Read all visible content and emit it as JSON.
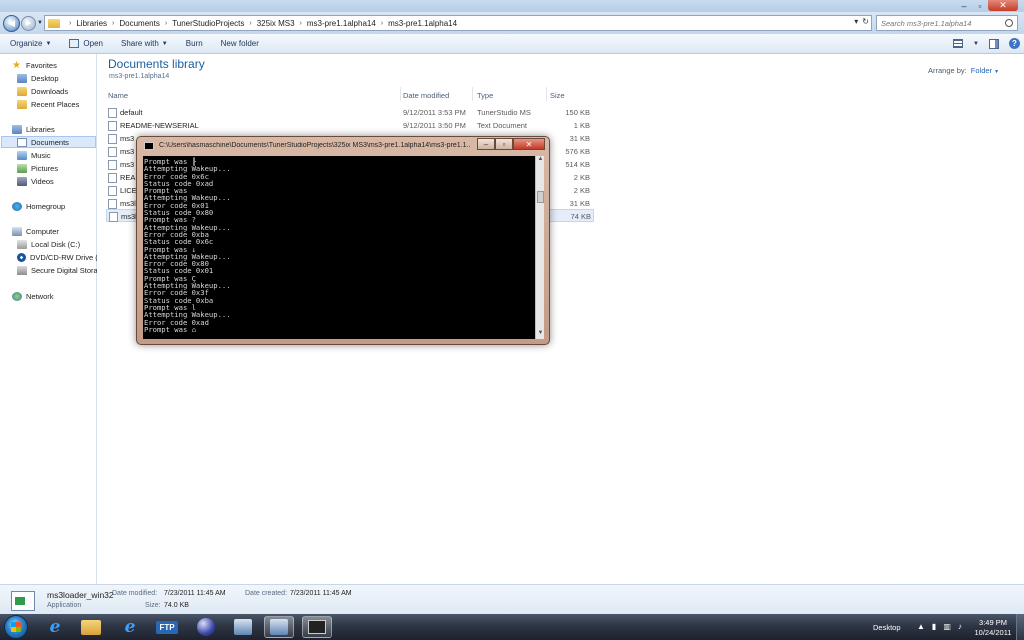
{
  "window_controls": {
    "minimize": "–",
    "maximize": "▫",
    "close": "✕"
  },
  "address": {
    "breadcrumbs": [
      "Libraries",
      "Documents",
      "TunerStudioProjects",
      "325ix MS3",
      "ms3-pre1.1alpha14",
      "ms3-pre1.1alpha14"
    ],
    "separator": "›"
  },
  "search": {
    "placeholder": "Search ms3-pre1.1alpha14"
  },
  "toolbar": {
    "organize": "Organize",
    "open": "Open",
    "share_with": "Share with",
    "burn": "Burn",
    "new_folder": "New folder",
    "help": "?"
  },
  "nav": {
    "favorites": "Favorites",
    "desktop": "Desktop",
    "downloads": "Downloads",
    "recent_places": "Recent Places",
    "libraries": "Libraries",
    "documents": "Documents",
    "music": "Music",
    "pictures": "Pictures",
    "videos": "Videos",
    "homegroup": "Homegroup",
    "computer": "Computer",
    "local_disk": "Local Disk (C:)",
    "dvd_drive": "DVD/CD-RW Drive (",
    "sd_storage": "Secure Digital Storag",
    "network": "Network"
  },
  "library": {
    "title": "Documents library",
    "subtitle": "ms3-pre1.1alpha14",
    "arrange_by_label": "Arrange by:",
    "arrange_by_value": "Folder"
  },
  "columns": {
    "name": "Name",
    "date": "Date modified",
    "type": "Type",
    "size": "Size"
  },
  "files": [
    {
      "name": "default",
      "date": "9/12/2011 3:53 PM",
      "type": "TunerStudio MS",
      "size": "150 KB"
    },
    {
      "name": "README-NEWSERIAL",
      "date": "9/12/2011 3:50 PM",
      "type": "Text Document",
      "size": "1 KB"
    },
    {
      "name": "ms3",
      "date": "",
      "type": "",
      "size": "31 KB"
    },
    {
      "name": "ms3",
      "date": "",
      "type": "",
      "size": "576 KB"
    },
    {
      "name": "ms3",
      "date": "",
      "type": "",
      "size": "514 KB"
    },
    {
      "name": "READ",
      "date": "",
      "type": "",
      "size": "2 KB"
    },
    {
      "name": "LICEN",
      "date": "",
      "type": "",
      "size": "2 KB"
    },
    {
      "name": "ms3l",
      "date": "",
      "type": "",
      "size": "31 KB"
    },
    {
      "name": "ms3l",
      "date": "",
      "type": "",
      "size": "74 KB"
    }
  ],
  "console": {
    "title": "C:\\Users\\hasmaschine\\Documents\\TunerStudioProjects\\325ix MS3\\ms3-pre1.1alpha14\\ms3-pre1.1...",
    "minimize": "–",
    "maximize": "▫",
    "close": "✕",
    "text": "Prompt was ╟\nAttempting Wakeup...\nError code 0x6c\nStatus code 0xad\nPrompt was\nAttempting Wakeup...\nError code 0x01\nStatus code 0x80\nPrompt was ?\nAttempting Wakeup...\nError code 0xba\nStatus code 0x6c\nPrompt was ↓\nAttempting Wakeup...\nError code 0x80\nStatus code 0x01\nPrompt was Ç\nAttempting Wakeup...\nError code 0x3f\nStatus code 0xba\nPrompt was l\nAttempting Wakeup...\nError code 0xad\nPrompt was ⌂"
  },
  "details": {
    "name": "ms3loader_win32",
    "type": "Application",
    "date_modified_label": "Date modified:",
    "date_modified": "7/23/2011 11:45 AM",
    "date_created_label": "Date created:",
    "date_created": "7/23/2011 11:45 AM",
    "size_label": "Size:",
    "size": "74.0 KB"
  },
  "taskbar": {
    "ftp_label": "FTP",
    "desktop_label": "Desktop",
    "time": "3:49 PM",
    "date": "10/24/2011"
  }
}
